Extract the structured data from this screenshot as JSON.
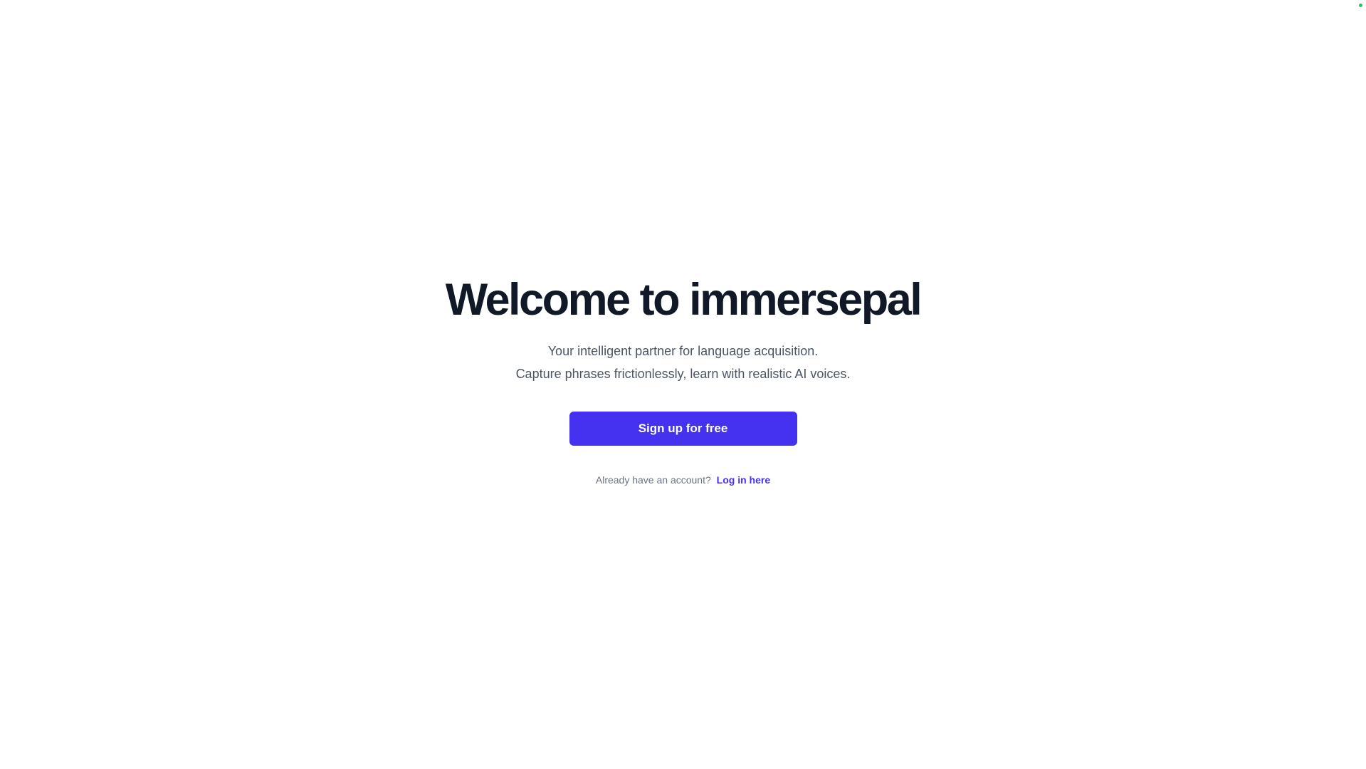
{
  "hero": {
    "title": "Welcome to immersepal",
    "tagline_line1": "Your intelligent partner for language acquisition.",
    "tagline_line2": "Capture phrases frictionlessly, learn with realistic AI voices."
  },
  "actions": {
    "signup_label": "Sign up for free",
    "login_prompt": "Already have an account?",
    "login_link": "Log in here"
  },
  "colors": {
    "accent": "#4532f1",
    "title": "#111827",
    "body_text": "#4b5563",
    "muted_text": "#6b7280",
    "status_dot": "#22c55e"
  },
  "icons": {
    "status": "status-dot-icon"
  }
}
